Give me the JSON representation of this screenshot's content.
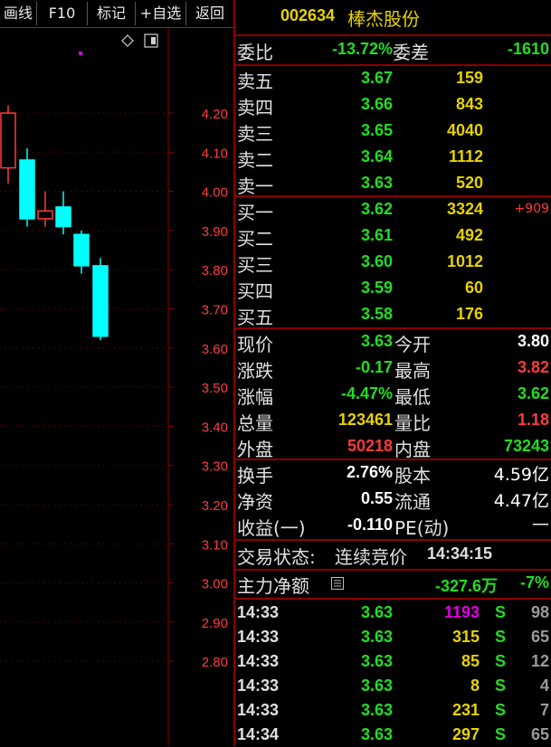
{
  "toolbar": {
    "items": [
      {
        "label": "画线"
      },
      {
        "label": "F10"
      },
      {
        "label": "标记"
      },
      {
        "label": "+自选"
      },
      {
        "label": "返回"
      }
    ]
  },
  "stock": {
    "code": "002634",
    "name": "棒杰股份"
  },
  "chart": {
    "price_axis": [
      "4.20",
      "4.10",
      "4.00",
      "3.90",
      "3.80",
      "3.70",
      "3.60",
      "3.50",
      "3.40",
      "3.30",
      "3.20",
      "3.10",
      "3.00",
      "2.90",
      "2.80"
    ],
    "price_values": [
      4.2,
      4.1,
      4.0,
      3.9,
      3.8,
      3.7,
      3.6,
      3.5,
      3.4,
      3.3,
      3.2,
      3.1,
      3.0,
      2.9,
      2.8
    ],
    "candles": [
      {
        "open": 4.06,
        "close": 4.2,
        "high": 4.22,
        "low": 4.02
      },
      {
        "open": 4.08,
        "close": 3.93,
        "high": 4.11,
        "low": 3.91
      },
      {
        "open": 3.93,
        "close": 3.95,
        "high": 4.0,
        "low": 3.91
      },
      {
        "open": 3.96,
        "close": 3.91,
        "high": 4.0,
        "low": 3.89
      },
      {
        "open": 3.89,
        "close": 3.81,
        "high": 3.9,
        "low": 3.79
      },
      {
        "open": 3.81,
        "close": 3.63,
        "high": 3.83,
        "low": 3.62
      }
    ],
    "colors": {
      "up": "#ff3b3b",
      "down": "#00ffff",
      "grid": "#8a0000"
    }
  },
  "weibi": {
    "label1": "委比",
    "value1": "-13.72%",
    "label2": "委差",
    "value2": "-1610"
  },
  "asks": [
    {
      "label": "卖五",
      "price": "3.67",
      "volume": "159"
    },
    {
      "label": "卖四",
      "price": "3.66",
      "volume": "843"
    },
    {
      "label": "卖三",
      "price": "3.65",
      "volume": "4040"
    },
    {
      "label": "卖二",
      "price": "3.64",
      "volume": "1112"
    },
    {
      "label": "卖一",
      "price": "3.63",
      "volume": "520"
    }
  ],
  "bids": [
    {
      "label": "买一",
      "price": "3.62",
      "volume": "3324",
      "change": "+909"
    },
    {
      "label": "买二",
      "price": "3.61",
      "volume": "492",
      "change": ""
    },
    {
      "label": "买三",
      "price": "3.60",
      "volume": "1012",
      "change": ""
    },
    {
      "label": "买四",
      "price": "3.59",
      "volume": "60",
      "change": ""
    },
    {
      "label": "买五",
      "price": "3.58",
      "volume": "176",
      "change": ""
    }
  ],
  "quote": [
    {
      "l1": "现价",
      "v1": "3.63",
      "c1": "green",
      "l2": "今开",
      "v2": "3.80",
      "c2": "white"
    },
    {
      "l1": "涨跌",
      "v1": "-0.17",
      "c1": "green",
      "l2": "最高",
      "v2": "3.82",
      "c2": "red"
    },
    {
      "l1": "涨幅",
      "v1": "-4.47%",
      "c1": "green",
      "l2": "最低",
      "v2": "3.62",
      "c2": "green"
    },
    {
      "l1": "总量",
      "v1": "123461",
      "c1": "yellow",
      "l2": "量比",
      "v2": "1.18",
      "c2": "red"
    },
    {
      "l1": "外盘",
      "v1": "50218",
      "c1": "red",
      "l2": "内盘",
      "v2": "73243",
      "c2": "green"
    }
  ],
  "fundamentals": [
    {
      "l1": "换手",
      "v1": "2.76%",
      "l2": "股本",
      "v2": "4.59亿"
    },
    {
      "l1": "净资",
      "v1": "0.55",
      "l2": "流通",
      "v2": "4.47亿"
    },
    {
      "l1": "收益(一)",
      "v1": "-0.110",
      "l2": "PE(动)",
      "v2": "—"
    }
  ],
  "status": {
    "label": "交易状态:",
    "state": "连续竞价",
    "time": "14:34:15"
  },
  "main_flow": {
    "label": "主力净额",
    "amount": "-327.6万",
    "pct": "-7%"
  },
  "ticks": [
    {
      "time": "14:33",
      "price": "3.63",
      "volume": "1193",
      "vcolor": "magenta",
      "side": "S",
      "count": "98"
    },
    {
      "time": "14:33",
      "price": "3.63",
      "volume": "315",
      "vcolor": "yellow",
      "side": "S",
      "count": "65"
    },
    {
      "time": "14:33",
      "price": "3.63",
      "volume": "85",
      "vcolor": "yellow",
      "side": "S",
      "count": "12"
    },
    {
      "time": "14:33",
      "price": "3.63",
      "volume": "8",
      "vcolor": "yellow",
      "side": "S",
      "count": "4"
    },
    {
      "time": "14:33",
      "price": "3.63",
      "volume": "231",
      "vcolor": "yellow",
      "side": "S",
      "count": "7"
    },
    {
      "time": "14:34",
      "price": "3.63",
      "volume": "297",
      "vcolor": "yellow",
      "side": "S",
      "count": "65"
    }
  ]
}
